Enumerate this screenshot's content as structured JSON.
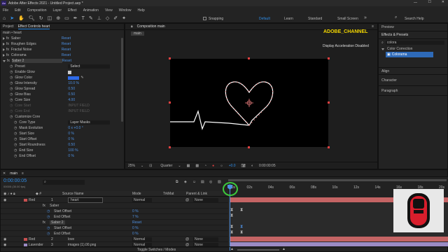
{
  "titlebar": {
    "title": "Adobe After Effects 2021 - Untitled Project.aep *"
  },
  "menu": [
    "File",
    "Edit",
    "Composition",
    "Layer",
    "Effect",
    "Animation",
    "View",
    "Window",
    "Help"
  ],
  "toolbar": {
    "snapping_label": "Snapping",
    "workspaces": [
      "Default",
      "Learn",
      "Standard",
      "Small Screen"
    ],
    "search_help_placeholder": "Search Help"
  },
  "left_panel": {
    "tabs": [
      "Project",
      "Effect Controls heart"
    ],
    "header": "main • heart",
    "effects": [
      {
        "name": "Saber",
        "value": "Reset"
      },
      {
        "name": "Roughen Edges",
        "value": "Reset"
      },
      {
        "name": "Fractal Noise",
        "value": "Reset"
      },
      {
        "name": "Colorama",
        "value": "Reset"
      },
      {
        "name": "Saber 2",
        "value": "Reset"
      }
    ],
    "saber2_props": [
      {
        "name": "Preset",
        "value": "Select"
      },
      {
        "name": "Enable Glow",
        "value": ""
      },
      {
        "name": "Glow Color",
        "value": ""
      },
      {
        "name": "Glow Intensity",
        "value": "10.0 %"
      },
      {
        "name": "Glow Spread",
        "value": "0.50"
      },
      {
        "name": "Glow Bias",
        "value": "0.50"
      },
      {
        "name": "Core Size",
        "value": "4.00"
      },
      {
        "name": "Core Start",
        "value": "INPUT FIELD"
      },
      {
        "name": "Core End",
        "value": "INPUT FIELD"
      },
      {
        "name": "Customize Core",
        "value": ""
      },
      {
        "name": "Core Type",
        "value": "Layer Masks"
      },
      {
        "name": "Mask Evolution",
        "value": "0 x +0.0 °"
      },
      {
        "name": "Start Size",
        "value": "0 %"
      },
      {
        "name": "Start Offset",
        "value": "0 %"
      },
      {
        "name": "Start Roundness",
        "value": "0.50"
      },
      {
        "name": "End Size",
        "value": "100 %"
      },
      {
        "name": "End Offset",
        "value": "0 %"
      }
    ]
  },
  "comp_panel": {
    "tab": "Composition main",
    "sub_tab": "main",
    "watermark": "ADOBE_CHANNEL",
    "accel_notice": "Display Acceleration Disabled",
    "zoom": "25%",
    "resolution": "Quarter",
    "exposure": "+0.0",
    "timecode": "0:00:00:05"
  },
  "right_panel": {
    "items": [
      "Preview",
      "Effects & Presets",
      "Align",
      "Character",
      "Paragraph"
    ],
    "search_value": "colora",
    "category": "Color Correction",
    "result": "Colorama"
  },
  "timeline": {
    "tab": "main",
    "timecode": "0:00:00:05",
    "fps": "00005 (30.00 fps)",
    "col_source": "Source Name",
    "col_mode": "Mode",
    "col_trkmat": "TrkMat",
    "col_parent": "Parent & Link",
    "ruler": [
      "00s",
      "02s",
      "04s",
      "06s",
      "08s",
      "10s",
      "12s",
      "14s",
      "16s",
      "18s",
      "20s"
    ],
    "footer": "Toggle Switches / Modes",
    "layers": [
      {
        "color": "Red",
        "num": "1",
        "name": "heart",
        "mode": "Normal",
        "parent": "None"
      },
      {
        "color": "",
        "num": "",
        "name": "Saber",
        "mode": "",
        "parent": ""
      },
      {
        "color": "",
        "num": "",
        "name": "Start Offset",
        "mode": "0 %",
        "parent": ""
      },
      {
        "color": "",
        "num": "",
        "name": "End Offset",
        "mode": "7 %",
        "parent": ""
      },
      {
        "color": "",
        "num": "",
        "name": "Saber 2",
        "mode": "Reset",
        "parent": ""
      },
      {
        "color": "",
        "num": "",
        "name": "Start Offset",
        "mode": "0 %",
        "parent": ""
      },
      {
        "color": "",
        "num": "",
        "name": "End Offset",
        "mode": "0 %",
        "parent": ""
      },
      {
        "color": "Red",
        "num": "2",
        "name": "love",
        "mode": "Normal",
        "parent": "None"
      },
      {
        "color": "Lavender",
        "num": "3",
        "name": "images (1).00.png",
        "mode": "Normal",
        "parent": "None"
      }
    ],
    "saber_reset": "Reset"
  },
  "colors": {
    "accent": "#2e8de8",
    "red_label": "#c85050",
    "timeline_bar": "#c46464",
    "lavender": "#9b8bc4"
  }
}
